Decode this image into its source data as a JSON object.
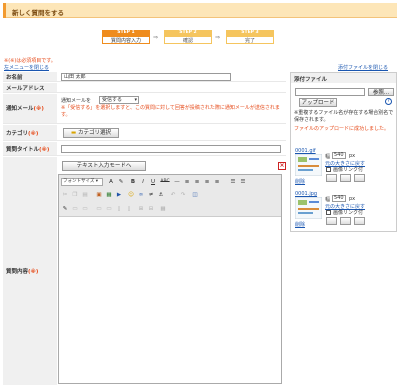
{
  "header": {
    "title": "新しく質問をする"
  },
  "steps": [
    {
      "label": "STEP 1",
      "name": "質問内容入力"
    },
    {
      "label": "STEP 2",
      "name": "確認"
    },
    {
      "label": "STEP 3",
      "name": "完了"
    }
  ],
  "step_arrow": "⇒",
  "required_note": "※(※)は必須項目です。",
  "menu_link": "左メニューを閉じる",
  "attach_link": "添付ファイルを閉じる",
  "form": {
    "name_label": "お名前",
    "name_value": "山田 太郎",
    "email_label": "メールアドレス",
    "notify_label": "通知メール",
    "required_mark": "(※)",
    "notify_prefix": "通知メールを",
    "notify_selected": "受信する",
    "notify_notice": "※「受信する」を選択しますと、この質問に対して回答が投稿された際に通知メールが送信されます。",
    "category_label": "カテゴリ",
    "category_button": "カテゴリ選択",
    "title_label": "質問タイトル",
    "content_label": "質問内容",
    "text_mode_button": "テキスト入力モードへ",
    "close_glyph": "×"
  },
  "editor": {
    "font_size": "フォントサイズ",
    "bold": "B",
    "italic": "I",
    "underline": "U",
    "strike": "ABC"
  },
  "attach_panel": {
    "title": "添付ファイル",
    "browse_button": "参照...",
    "upload_button": "アップロード",
    "help_glyph": "?",
    "note": "※重複するファイル名が存在する場合別名で保存されます。",
    "success": "ファイルのアップロードに成功しました。",
    "files": [
      {
        "name": "0001.gif",
        "width_label": "幅",
        "width_value": "540",
        "unit": "px",
        "restore": "元の大きさに戻す",
        "link_label": "画像リンク付",
        "delete": "削除"
      },
      {
        "name": "0001.jpg",
        "width_label": "幅",
        "width_value": "540",
        "unit": "px",
        "restore": "元の大きさに戻す",
        "link_label": "画像リンク付",
        "delete": "削除"
      }
    ]
  },
  "colors": {
    "accent": "#ef8c1d",
    "step_inactive": "#f5c55e",
    "required": "#e64a19",
    "link": "#1a56b0"
  }
}
